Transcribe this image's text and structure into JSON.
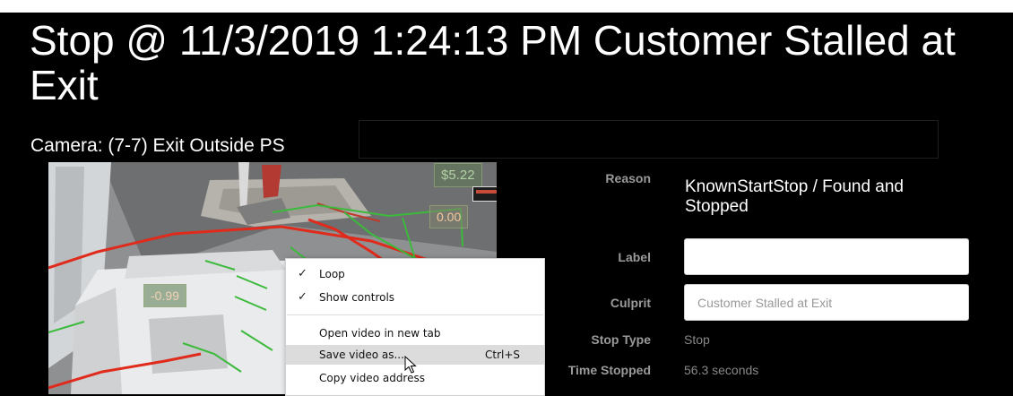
{
  "page": {
    "title": "Stop @ 11/3/2019 1:24:13 PM Customer Stalled at Exit",
    "camera": "Camera: (7-7) Exit Outside PS"
  },
  "video": {
    "overlay_price": "$5.22",
    "overlay_zero": "0.00",
    "overlay_negative": "-0.99"
  },
  "context_menu": {
    "items": [
      {
        "label": "Loop",
        "checked": true
      },
      {
        "label": "Show controls",
        "checked": true
      },
      {
        "label": "Open video in new tab"
      },
      {
        "label": "Save video as...",
        "shortcut": "Ctrl+S",
        "highlighted": true
      },
      {
        "label": "Copy video address"
      }
    ]
  },
  "details": {
    "reason_label": "Reason",
    "reason_value": "KnownStartStop / Found and Stopped",
    "label_label": "Label",
    "label_value": "",
    "culprit_label": "Culprit",
    "culprit_placeholder": "Customer Stalled at Exit",
    "stop_type_label": "Stop Type",
    "stop_type_value": "Stop",
    "time_stopped_label": "Time Stopped",
    "time_stopped_value": "56.3 seconds"
  },
  "colors": {
    "background": "#000000",
    "text": "#ffffff",
    "label_gray": "#9a9a9a",
    "tracking_red": "#e02a1c",
    "tracking_green": "#3cba3c"
  }
}
